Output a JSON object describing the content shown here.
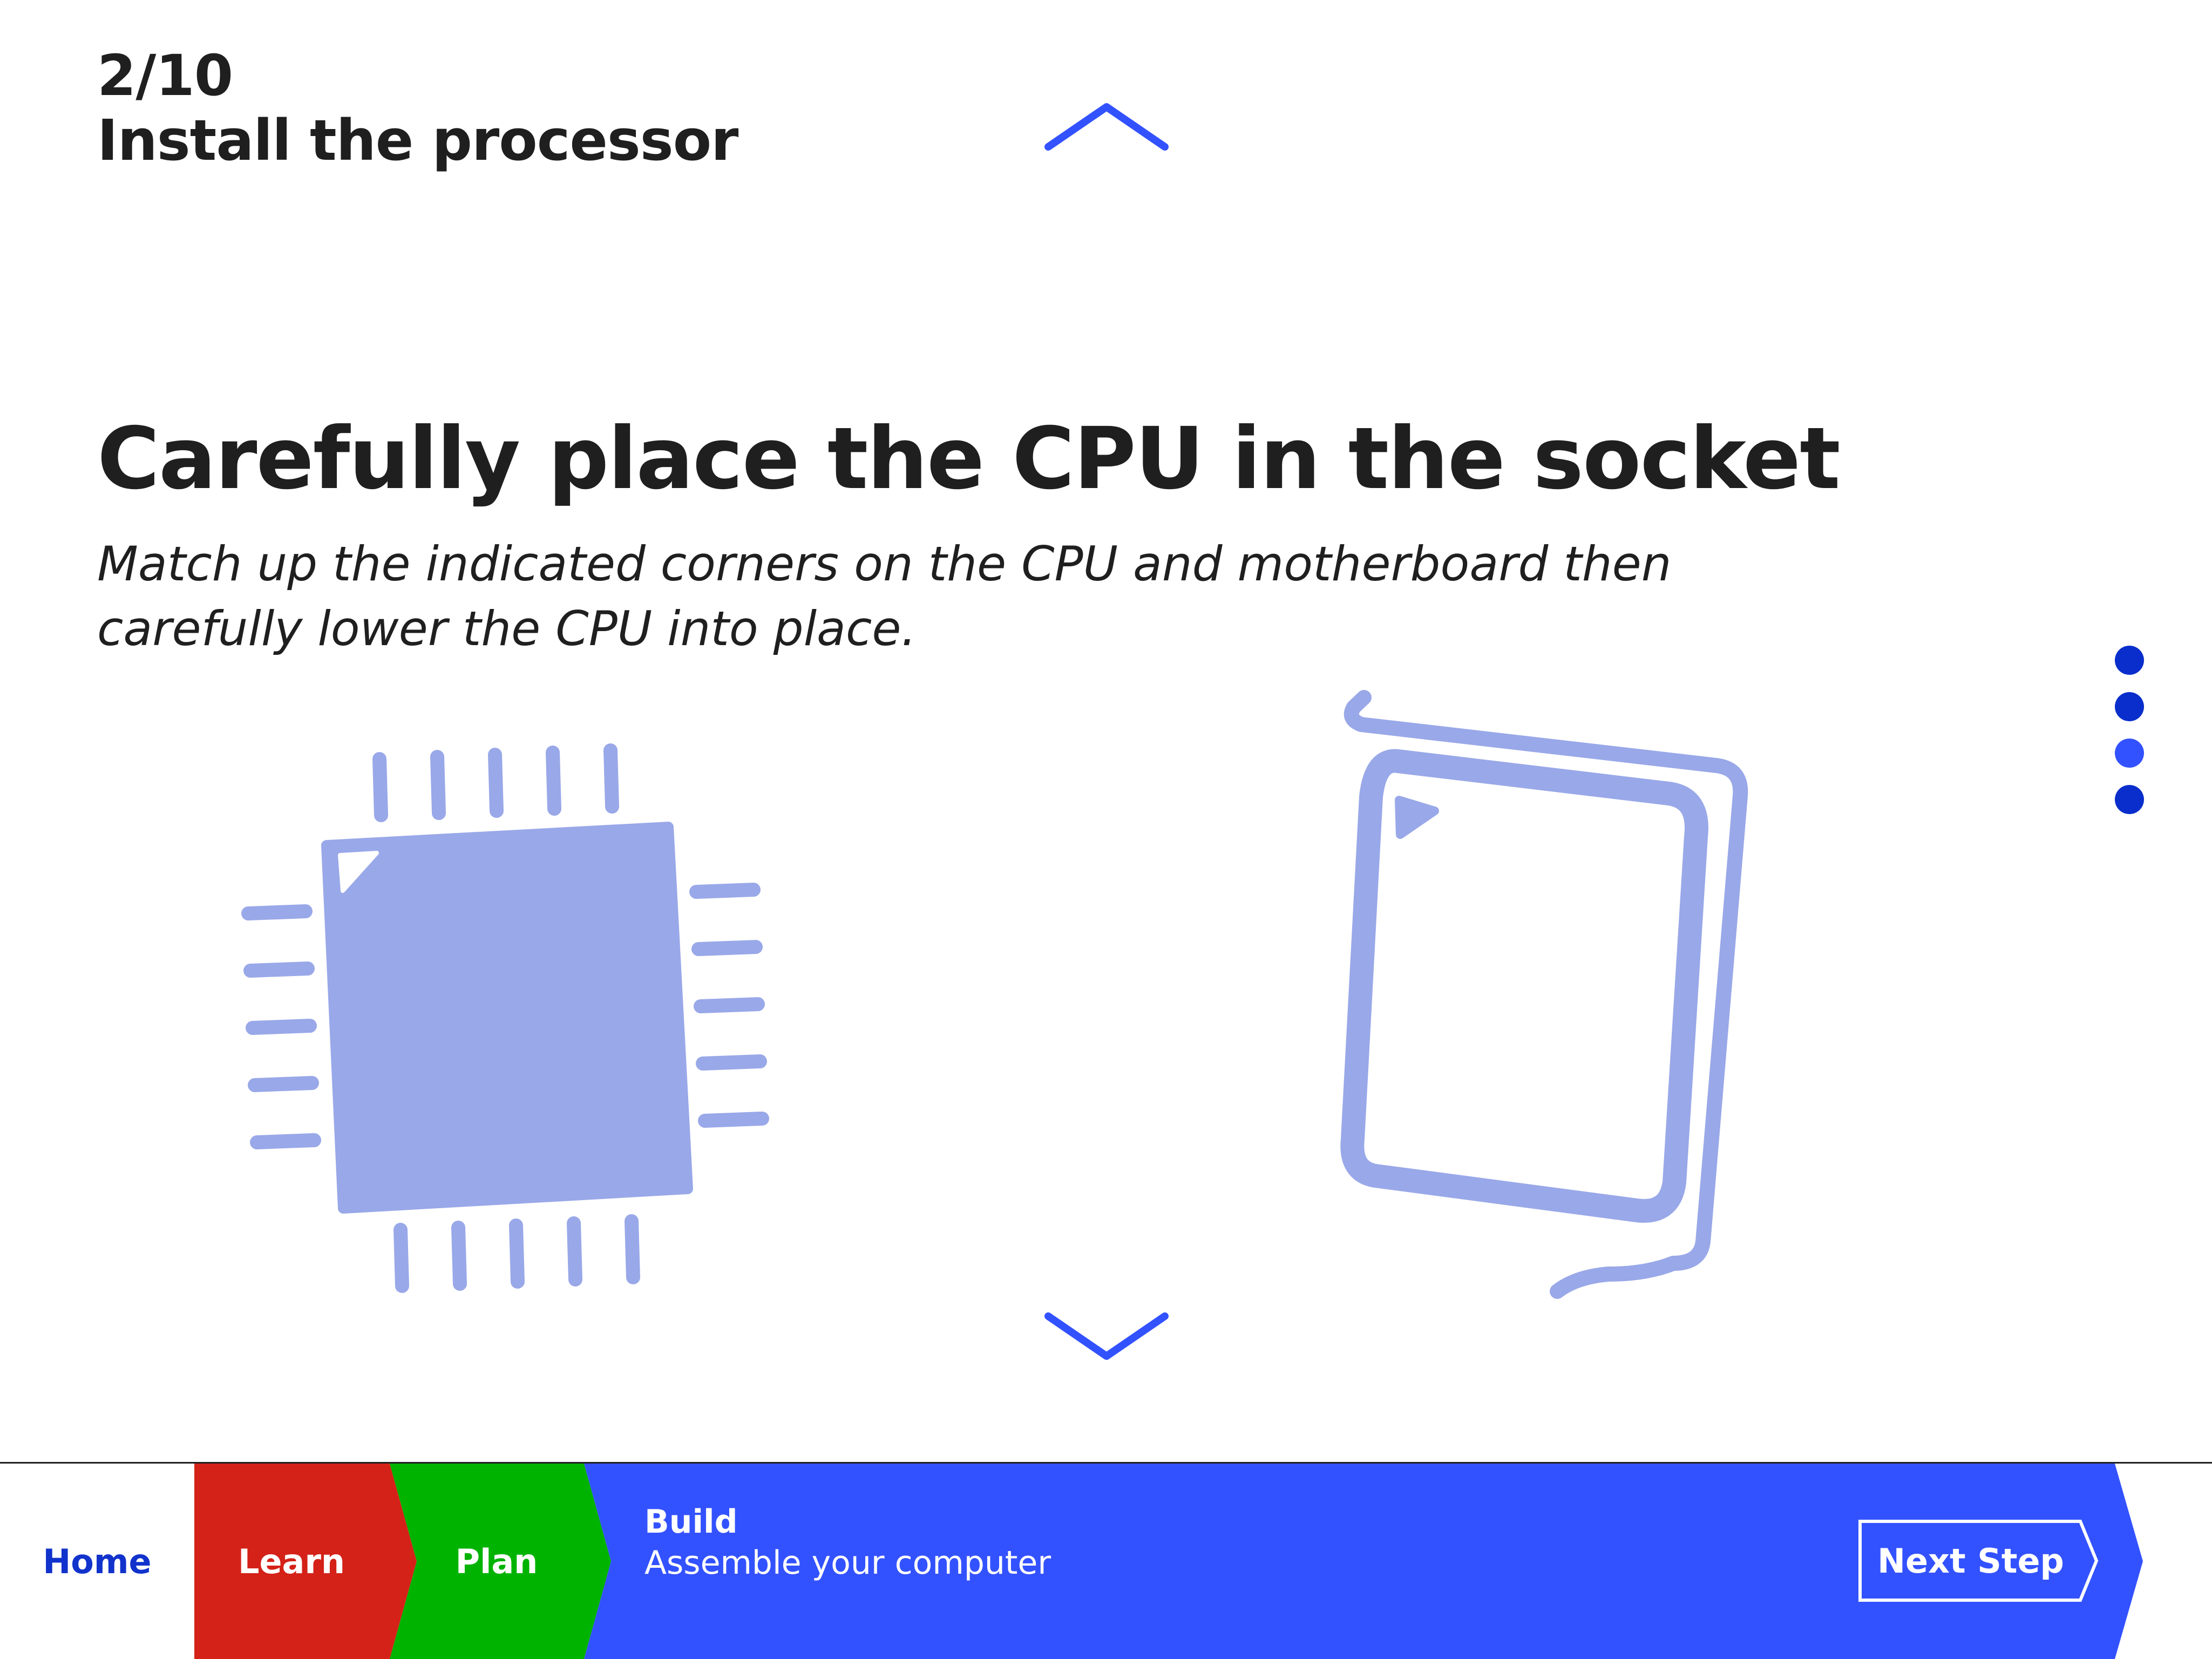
{
  "step": {
    "counter": "2/10",
    "title": "Install the processor"
  },
  "content": {
    "headline": "Carefully place the CPU in the socket",
    "description": "Match up the indicated corners on the CPU and motherboard then carefully lower the CPU into place."
  },
  "pager": {
    "dots": [
      {
        "state": "inactive"
      },
      {
        "state": "inactive"
      },
      {
        "state": "active"
      },
      {
        "state": "inactive"
      }
    ]
  },
  "icons": {
    "nav_up": "chevron-up-icon",
    "nav_down": "chevron-down-icon",
    "illustration_left": "cpu-chip-icon",
    "illustration_right": "cpu-socket-icon"
  },
  "bottom_nav": {
    "home": "Home",
    "learn": "Learn",
    "plan": "Plan",
    "current_title": "Build",
    "current_subtitle": "Assemble your computer",
    "next_button": "Next Step"
  },
  "colors": {
    "accent_blue": "#3352ff",
    "dark_blue": "#0a2ecc",
    "learn_red": "#d42218",
    "plan_green": "#00b300",
    "illustration": "#99a8e8",
    "text": "#1f1f1f"
  }
}
